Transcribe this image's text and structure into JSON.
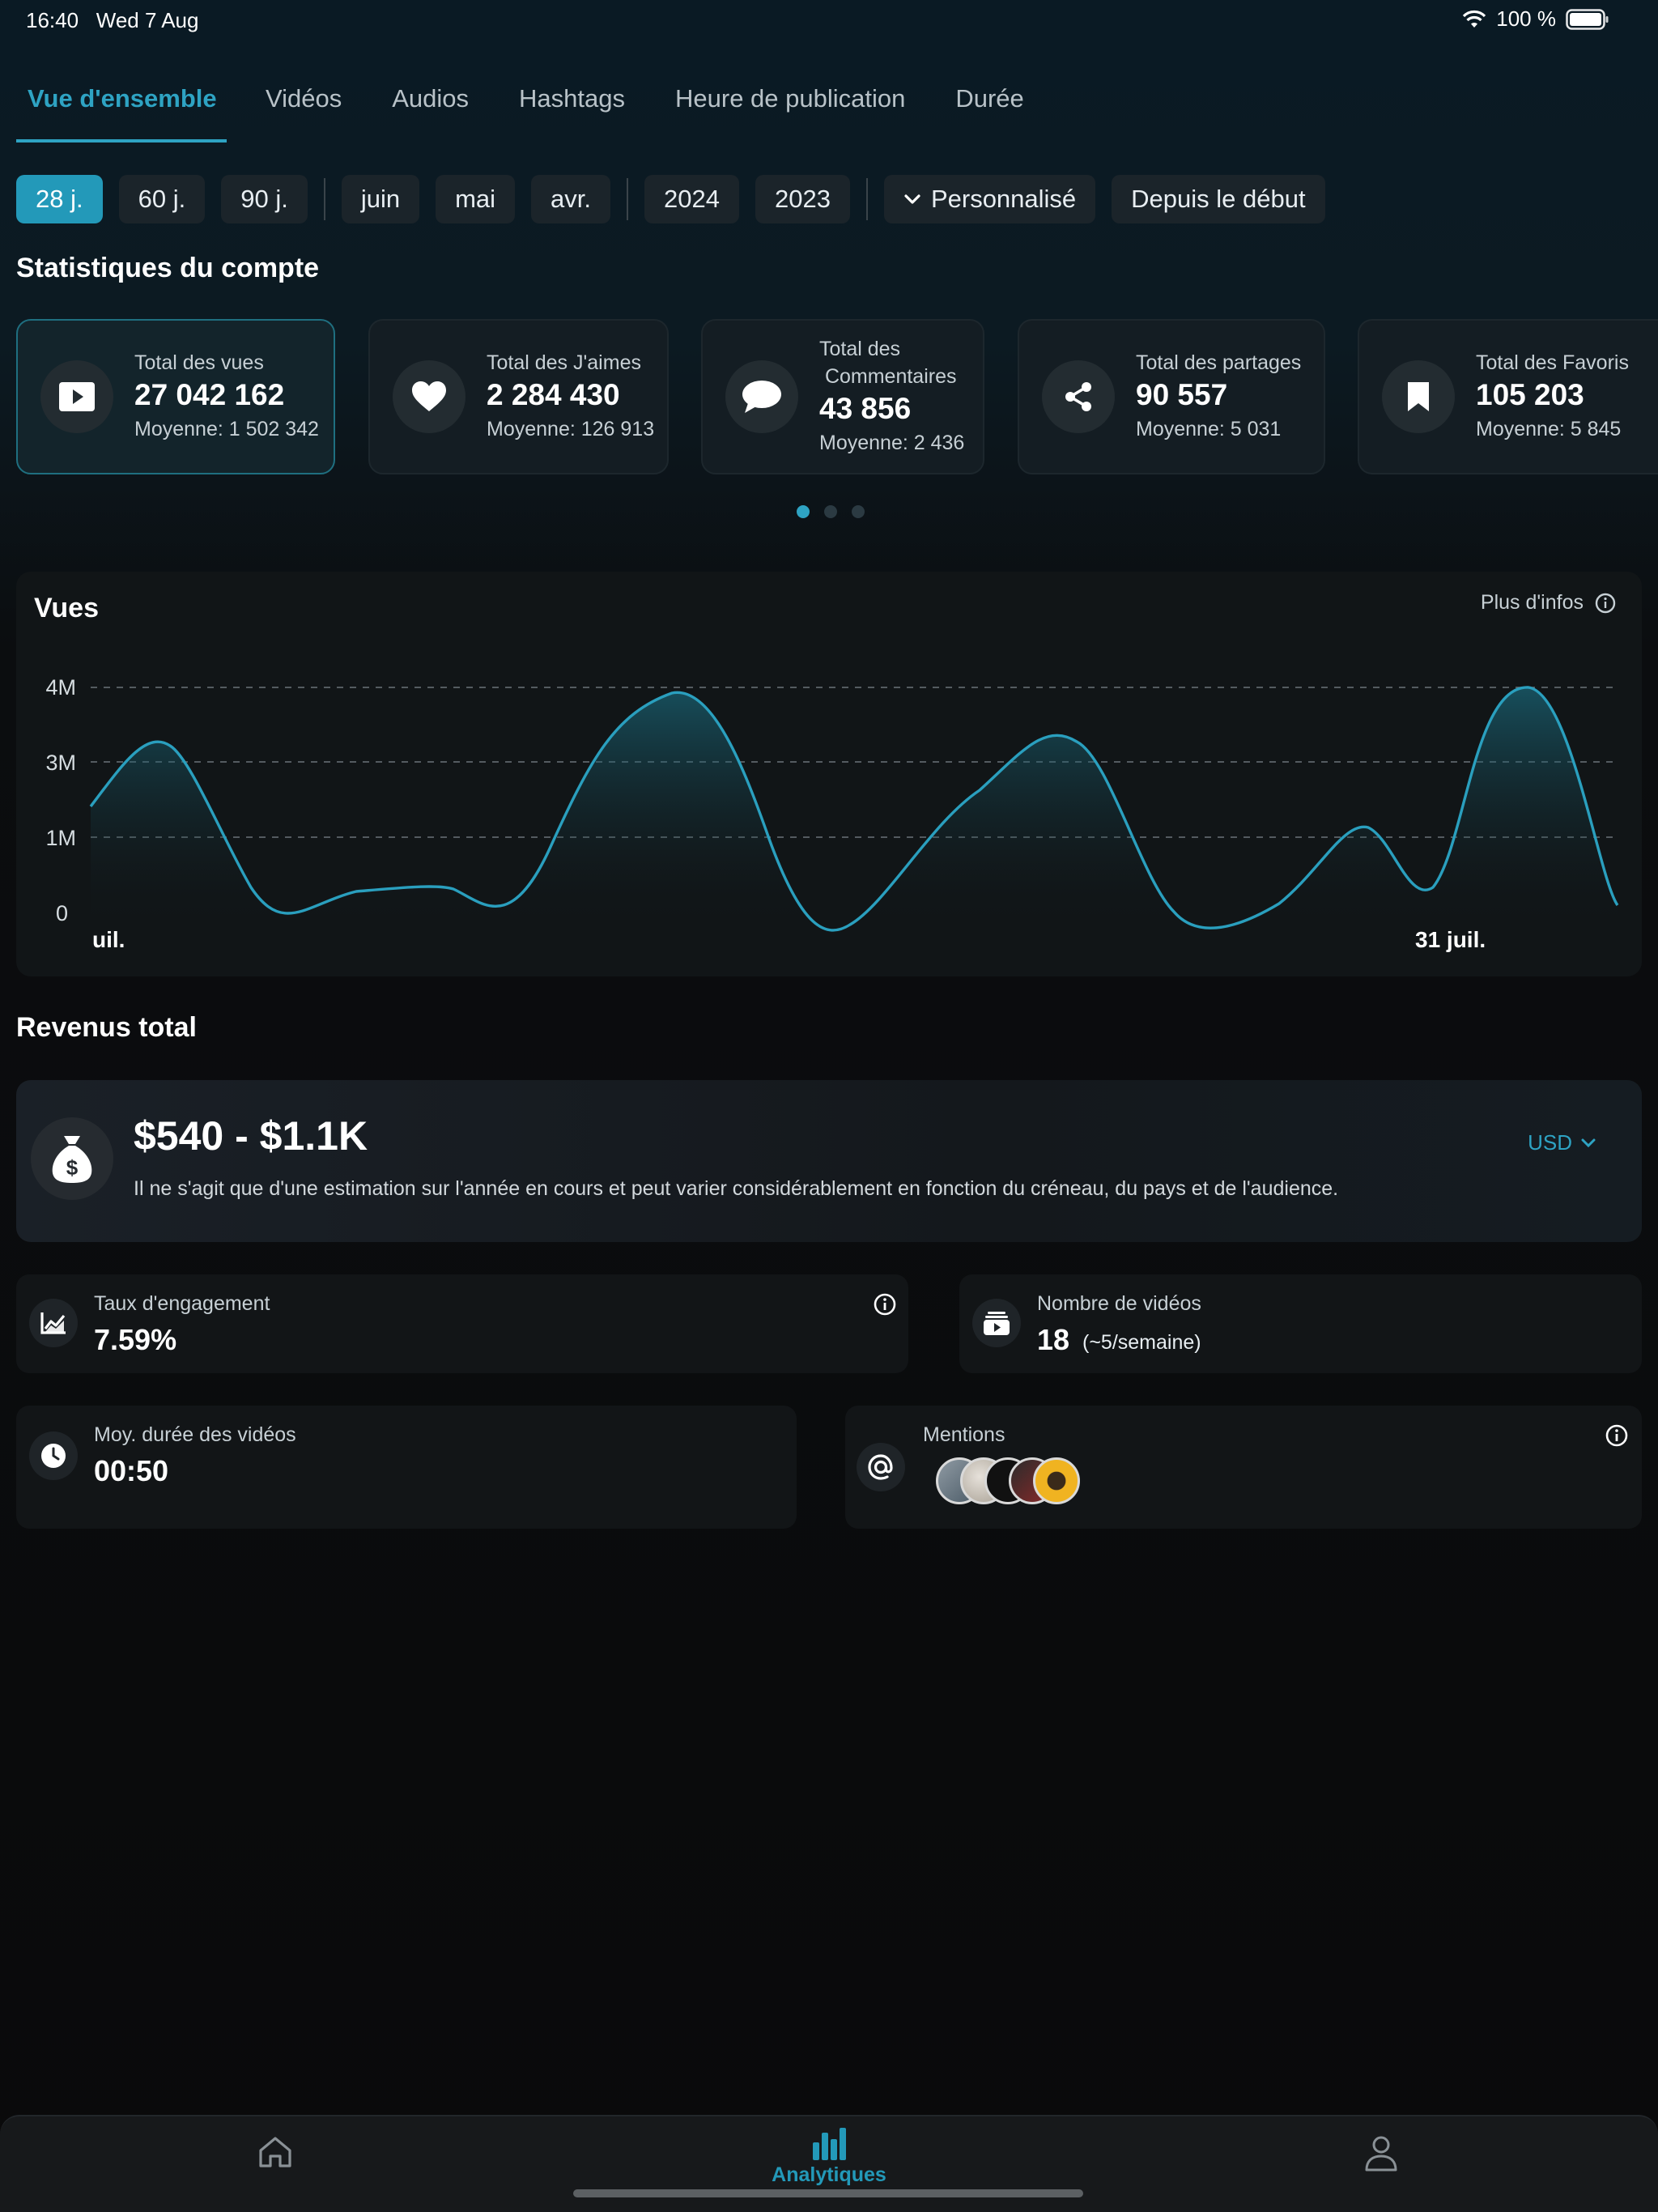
{
  "status": {
    "time": "16:40",
    "date": "Wed 7 Aug",
    "battery": "100 %"
  },
  "tabs": [
    {
      "label": "Vue d'ensemble"
    },
    {
      "label": "Vidéos"
    },
    {
      "label": "Audios"
    },
    {
      "label": "Hashtags"
    },
    {
      "label": "Heure de publication"
    },
    {
      "label": "Durée"
    }
  ],
  "filters": {
    "ranges": [
      "28 j.",
      "60 j.",
      "90 j."
    ],
    "months": [
      "juin",
      "mai",
      "avr."
    ],
    "years": [
      "2024",
      "2023"
    ],
    "custom": "Personnalisé",
    "since_start": "Depuis le début"
  },
  "account_stats": {
    "title": "Statistiques du compte",
    "cards": [
      {
        "label": "Total des vues",
        "value": "27 042 162",
        "avg": "Moyenne: 1 502 342"
      },
      {
        "label": "Total des J'aimes",
        "value": "2 284 430",
        "avg": "Moyenne: 126 913"
      },
      {
        "label": "Total des",
        "label2": " Commentaires",
        "value": "43 856",
        "avg": "Moyenne: 2 436"
      },
      {
        "label": "Total des partages",
        "value": "90 557",
        "avg": "Moyenne: 5 031"
      },
      {
        "label": "Total des Favoris",
        "value": "105 203",
        "avg": "Moyenne: 5 845"
      }
    ]
  },
  "views_chart": {
    "title": "Vues",
    "more_info": "Plus d'infos",
    "yticks": [
      "4M",
      "3M",
      "1M",
      "0"
    ],
    "xlabels": [
      "uil.",
      "31 juil."
    ],
    "accent": "#2a9fbe"
  },
  "revenue": {
    "title": "Revenus total",
    "value": "$540 - $1.1K",
    "description": "Il ne s'agit que d'une estimation sur l'année en cours et peut varier considérablement en fonction du créneau, du pays et de l'audience.",
    "currency": "USD"
  },
  "metrics": {
    "engagement": {
      "label": "Taux d'engagement",
      "value": "7.59%"
    },
    "videos": {
      "label": "Nombre de vidéos",
      "value": "18",
      "extra": "(~5/semaine)"
    },
    "duration": {
      "label": "Moy. durée des vidéos",
      "value": "00:50"
    },
    "mentions": {
      "label": "Mentions"
    }
  },
  "bottom_nav": {
    "analytics_label": "Analytiques"
  }
}
